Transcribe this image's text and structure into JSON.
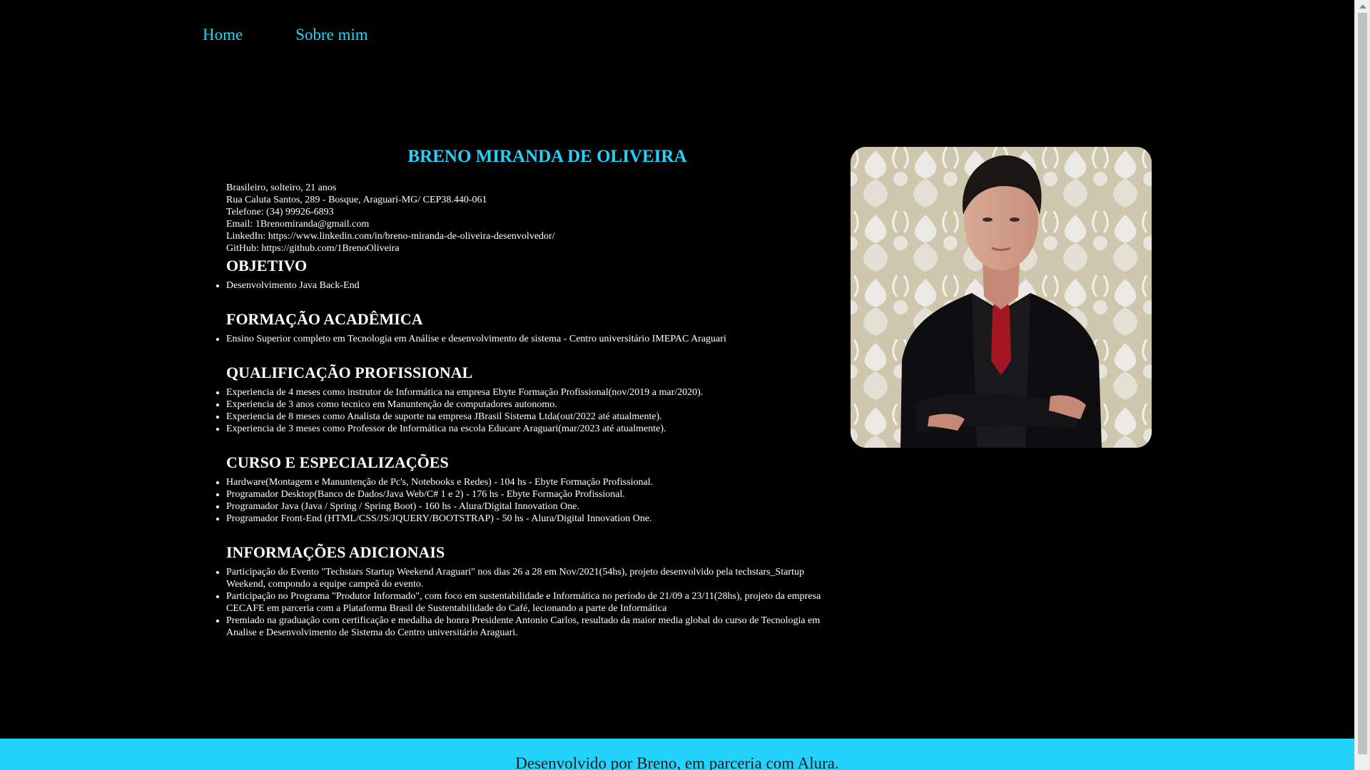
{
  "nav": {
    "home": "Home",
    "about": "Sobre mim"
  },
  "profile": {
    "name": "BRENO MIRANDA DE OLIVEIRA",
    "info": [
      "Brasileiro, solteiro, 21 anos",
      "Rua Caluta Santos, 289 - Bosque, Araguari-MG/ CEP38.440-061",
      "Telefone: (34) 99926-6893",
      "Email: 1Brenomiranda@gmail.com",
      "LinkedIn: https://www.linkedin.com/in/breno-miranda-de-oliveira-desenvolvedor/",
      "GitHub: https://github.com/1BrenoOliveira"
    ]
  },
  "sections": [
    {
      "title": "OBJETIVO",
      "items": [
        "Desenvolvimento Java Back-End"
      ]
    },
    {
      "title": "FORMAÇÃO ACADÊMICA",
      "items": [
        "Ensino Superior completo em Tecnologia em Análise e desenvolvimento de sistema - Centro universitário IMEPAC Araguari"
      ]
    },
    {
      "title": "QUALIFICAÇÃO PROFISSIONAL",
      "items": [
        "Experiencia de 4 meses como instrutor de Informática na empresa Ebyte Formação Profissional(nov/2019 a mar/2020).",
        "Experiencia de 3 anos como tecnico em Manuntenção de computadores autonomo.",
        "Experiencia de 8 meses como Analista de suporte na empresa JBrasil Sistema Ltda(out/2022 até atualmente).",
        "Experiencia de 3 meses como Professor de Informática na escola Educare Araguari(mar/2023 até atualmente)."
      ]
    },
    {
      "title": "CURSO E ESPECIALIZAÇÕES",
      "items": [
        "Hardware(Montagem e Manuntenção de Pc's, Notebooks e Redes) - 104 hs - Ebyte Formação Profissional.",
        "Programador Desktop(Banco de Dados/Java Web/C# 1 e 2) - 176 hs - Ebyte Formação Profissional.",
        "Programador Java (Java / Spring / Spring Boot) - 160 hs - Alura/Digital Innovation One.",
        "Programador Front-End (HTML/CSS/JS/JQUERY/BOOTSTRAP) - 50 hs - Alura/Digital Innovation One."
      ]
    },
    {
      "title": "INFORMAÇÕES ADICIONAIS",
      "items": [
        "Participação do Evento \"Techstars Startup Weekend Araguari\" nos dias 26 a 28 em Nov/2021(54hs), projeto desenvolvido pela techstars_Startup Weekend, compondo a equipe campeã do evento.",
        "Participação no Programa \"Produtor Informado\", com foco em sustentabilidade e Informática no período de 21/09 a 23/11(28hs), projeto da empresa CECAFE em parceria com a Plataforma Brasil de Sustentabilidade do Café, lecionando a parte de Informática",
        "Premiado na graduação com certificação e medalha de honra Presidente Antonio Carlos, resultado da maior media global do curso de Tecnologia em Analise e Desenvolvimento de Sistema do Centro universitário Araguari."
      ]
    }
  ],
  "footer": {
    "text": "Desenvolvido por Breno, em parceria com Alura."
  },
  "colors": {
    "accent": "#22d4fd",
    "background": "#000000",
    "text": "#ffffff"
  }
}
